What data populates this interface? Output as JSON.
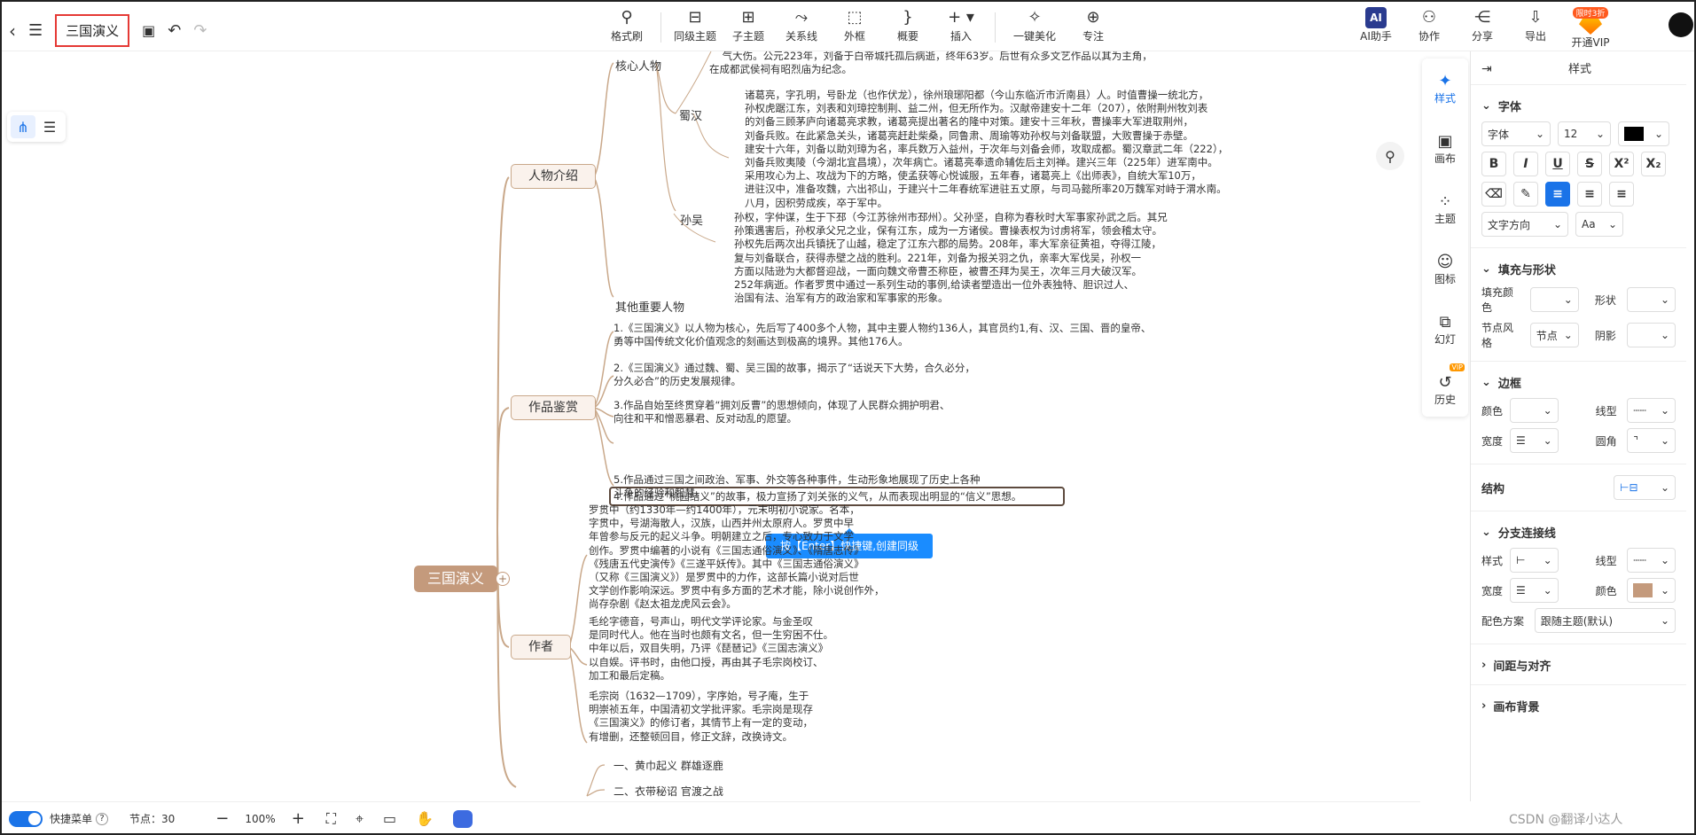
{
  "toolbar": {
    "title": "三国演义",
    "tools": [
      "格式刷",
      "同级主题",
      "子主题",
      "关系线",
      "外框",
      "概要",
      "插入",
      "一键美化",
      "专注"
    ],
    "right_tools": {
      "ai": "AI助手",
      "collab": "协作",
      "share": "分享",
      "export": "导出"
    },
    "vip_tag": "限时3折",
    "vip_label": "开通VIP"
  },
  "canvas": {
    "root": "三国演义",
    "topics": [
      "人物介绍",
      "作品鉴赏",
      "作者"
    ],
    "sub_labels": {
      "core": "核心人物",
      "shu": "蜀汉",
      "wu": "孙吴",
      "others": "其他重要人物"
    },
    "top_text": "    气大伤。公元223年，刘备于白帝城托孤后病逝，终年63岁。后世有众多文艺作品以其为主角，\n在成都武侯祠有昭烈庙为纪念。",
    "shu_text": "诸葛亮，字孔明，号卧龙（也作伏龙），徐州琅琊阳都（今山东临沂市沂南县）人。时值曹操一统北方，\n孙权虎踞江东，刘表和刘璋控制荆、益二州，但无所作为。汉献帝建安十二年（207），依附荆州牧刘表\n的刘备三顾茅庐向诸葛亮求教，诸葛亮提出著名的隆中对策。建安十三年秋，曹操率大军进取荆州，\n刘备兵败。在此紧急关头，诸葛亮赶赴柴桑，同鲁肃、周瑜等劝孙权与刘备联盟，大败曹操于赤壁。\n建安十六年，刘备以助刘璋为名，率兵数万入益州，于次年与刘备会师，攻取成都。蜀汉章武二年（222），\n刘备兵败夷陵（今湖北宜昌境），次年病亡。诸葛亮奉遗命辅佐后主刘禅。建兴三年（225年）进军南中。\n采用攻心为上、攻战为下的方略，使孟获等心悦诚服，五年春，诸葛亮上《出师表》，自统大军10万，\n进驻汉中，准备攻魏，六出祁山，于建兴十二年春统军进驻五丈原，与司马懿所率20万魏军对峙于渭水南。\n八月，因积劳成疾，卒于军中。",
    "wu_text": "孙权，字仲谋，生于下邳（今江苏徐州市邳州）。父孙坚，自称为春秋时大军事家孙武之后。其兄\n孙策遇害后，孙权承父兄之业，保有江东，成为一方诸侯。曹操表权为讨虏将军，领会稽太守。\n孙权先后两次出兵镇抚了山越，稳定了江东六郡的局势。208年，率大军亲征黄祖，夺得江陵，\n复与刘备联合，获得赤壁之战的胜利。221年，刘备为报关羽之仇，亲率大军伐吴，孙权一\n方面以陆逊为大都督迎战，一面向魏文帝曹丕称臣，被曹丕拜为吴王，次年三月大破汉军。\n252年病逝。作者罗贯中通过一系列生动的事例,给读者塑造出一位外表独特、胆识过人、\n治国有法、治军有方的政治家和军事家的形象。",
    "review_1a": "1.《三国演义》以人物为核心，先后写了400多个人物，其中主要人物约136人，其官员约1,有、汉、三国、晋的皇帝、",
    "review_1b": "勇等中国传统文化价值观念的刻画达到极高的境界。其他176人。",
    "review_2": "2.《三国演义》通过魏、蜀、吴三国的故事，揭示了“话说天下大势，合久必分，\n分久必合”的历史发展规律。",
    "review_3": "3.作品自始至终贯穿着“拥刘反曹”的思想倾向，体现了人民群众拥护明君、\n向往和平和憎恶暴君、反对动乱的愿望。",
    "review_4": "4.作品通过“桃园结义”的故事，极力宣扬了刘关张的义气，从而表现出明显的“信义”思想。",
    "review_5": "5.作品通过三国之间政治、军事、外交等各种事件，生动形象地展现了历史上各种\n斗争的经验和智慧。",
    "tooltip": "按【Enter】快捷键,创建同级",
    "author_1": "罗贯中（约1330年—约1400年），元末明初小说家。名本，\n字贯中，号湖海散人，汉族，山西并州太原府人。罗贯中早\n年曾参与反元的起义斗争。明朝建立之后，专心致力于文学\n创作。罗贯中编著的小说有《三国志通俗演义》、《隋唐志传》\n《残唐五代史演传》《三遂平妖传》。其中《三国志通俗演义》\n（又称《三国演义》）是罗贯中的力作，这部长篇小说对后世\n文学创作影响深远。罗贯中有多方面的艺术才能，除小说创作外，\n尚存杂剧《赵太祖龙虎风云会》。",
    "author_2": "毛纶字德音，号声山，明代文学评论家。与金圣叹\n是同时代人。他在当时也颇有文名，但一生穷困不仕。\n中年以后，双目失明，乃评《琵琶记》《三国志演义》\n以自娱。评书时，由他口授，再由其子毛宗岗校订、\n加工和最后定稿。",
    "author_3": "毛宗岗（1632—1709），字序始，号孑庵，生于\n明崇祯五年，中国清初文学批评家。毛宗岗是现存\n《三国演义》的修订者，其情节上有一定的变动，\n有增删，还整顿回目，修正文辞，改换诗文。",
    "chapter_1": "一、黄巾起义 群雄逐鹿",
    "chapter_2": "二、衣带秘诏 官渡之战"
  },
  "strip": [
    "样式",
    "画布",
    "主题",
    "图标",
    "幻灯",
    "历史"
  ],
  "strip_vip": "VIP",
  "panel": {
    "title": "样式",
    "font_section": "字体",
    "font_family": "字体",
    "font_size": "12",
    "text_direction": "文字方向",
    "fill_section": "填充与形状",
    "fill_color": "填充颜色",
    "shape": "形状",
    "node_style": "节点风格",
    "node_style_value": "节点",
    "shadow": "阴影",
    "border_section": "边框",
    "border_color": "颜色",
    "line_type": "线型",
    "width": "宽度",
    "radius": "圆角",
    "structure": "结构",
    "branch_section": "分支连接线",
    "branch_style": "样式",
    "branch_line": "线型",
    "branch_width": "宽度",
    "branch_color": "颜色",
    "color_scheme": "配色方案",
    "color_scheme_value": "跟随主题(默认)",
    "spacing": "间距与对齐",
    "canvas_bg": "画布背景"
  },
  "bottom": {
    "quick_menu": "快捷菜单",
    "nodes": "节点：30",
    "zoom": "100%"
  },
  "watermark": "CSDN @翻译小达人",
  "colors": {
    "accent": "#1a73e8",
    "branch": "#c49a7c",
    "selected": "#5d4a3e"
  }
}
